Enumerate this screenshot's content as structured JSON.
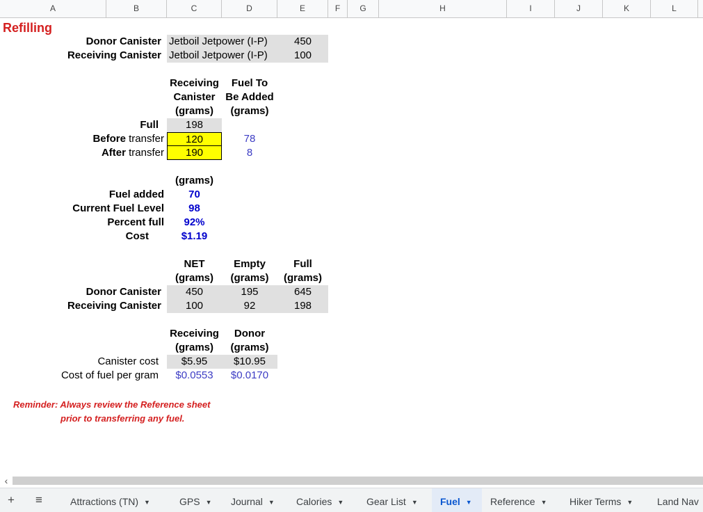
{
  "columns": [
    "A",
    "B",
    "C",
    "D",
    "E",
    "F",
    "G",
    "H",
    "I",
    "J",
    "K",
    "L"
  ],
  "title": "Refilling",
  "canisters": {
    "donor_label": "Donor Canister",
    "donor_model": "Jetboil Jetpower (I-P)",
    "donor_amount": "450",
    "receiving_label": "Receiving Canister",
    "receiving_model": "Jetboil Jetpower (I-P)",
    "receiving_amount": "100"
  },
  "transfer": {
    "hdr_receiving": [
      "Receiving",
      "Canister",
      "(grams)"
    ],
    "hdr_fuel": [
      "Fuel To",
      "Be Added",
      "(grams)"
    ],
    "full_label": "Full",
    "full_value": "198",
    "before_bold": "Before",
    "before_rest": " transfer",
    "before_value": "120",
    "before_fuel": "78",
    "after_bold": "After",
    "after_rest": " transfer",
    "after_value": "190",
    "after_fuel": "8"
  },
  "summary": {
    "unit": "(grams)",
    "fuel_added_label": "Fuel added",
    "fuel_added": "70",
    "current_label": "Current Fuel Level",
    "current": "98",
    "percent_label": "Percent full",
    "percent": "92%",
    "cost_label": "Cost",
    "cost": "$1.19"
  },
  "weights": {
    "hdr_net": [
      "NET",
      "(grams)"
    ],
    "hdr_empty": [
      "Empty",
      "(grams)"
    ],
    "hdr_full": [
      "Full",
      "(grams)"
    ],
    "donor_label": "Donor Canister",
    "donor": [
      "450",
      "195",
      "645"
    ],
    "receiving_label": "Receiving Canister",
    "receiving": [
      "100",
      "92",
      "198"
    ]
  },
  "costs": {
    "hdr_receiving": [
      "Receiving",
      "(grams)"
    ],
    "hdr_donor": [
      "Donor",
      "(grams)"
    ],
    "canister_cost_label": "Canister cost",
    "receiving_cost": "$5.95",
    "donor_cost": "$10.95",
    "per_gram_label": "Cost of fuel per gram",
    "receiving_per_gram": "$0.0553",
    "donor_per_gram": "$0.0170"
  },
  "reminder": [
    "Reminder: Always review the Reference sheet",
    "prior to transferring any fuel."
  ],
  "tabs": {
    "add_icon": "plus-icon",
    "list_icon": "menu-icon",
    "items": [
      "Attractions (TN)",
      "GPS",
      "Journal",
      "Calories",
      "Gear List",
      "Fuel",
      "Reference",
      "Hiker Terms",
      "Land Nav"
    ],
    "active": "Fuel"
  },
  "colors": {
    "title_red": "#d41f1f",
    "value_blue": "#3c3cc4",
    "highlight_yellow": "#ffff00",
    "active_tab": "#0b57d0"
  }
}
